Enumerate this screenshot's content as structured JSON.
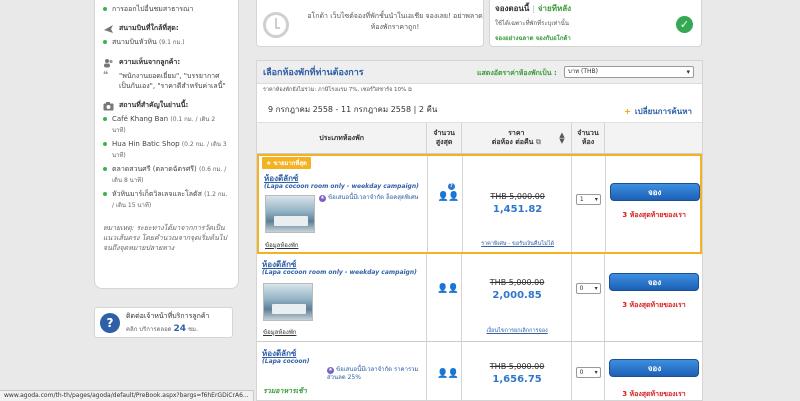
{
  "left": {
    "top_bullet": "การออกไปอื่นชมสาธารณา",
    "airport": {
      "heading": "สนามบินที่ใกล้ที่สุด:",
      "item": "สนามบินหัวหิน",
      "item_dist": "(9.1 กม.)"
    },
    "reviews": {
      "heading": "ความเห็นจากลูกค้า:",
      "quote": "\"พนักงานยอดเยี่ยม\", \"บรรยากาศเป็นกันเอง\", \"ราคาดีสำหรับค่าเลนี้\""
    },
    "landmarks": {
      "heading": "สถานที่สำคัญในย่านนี้:",
      "items": [
        {
          "name": "Café Khang Ban",
          "dist": "(0.1 กม. / เดิน 2 นาที)"
        },
        {
          "name": "Hua Hin Batic Shop",
          "dist": "(0.2 กม. / เดิน 3 นาที)"
        },
        {
          "name": "ตลาดสวนศรี (ตลาดฉัตรศรี)",
          "dist": "(0.6 กม. / เดิน 8 นาที)"
        },
        {
          "name": "หัวหินมาร์เก็ตวิลเลจและโลตัส",
          "dist": "(1.2 กม. / เดิน 15 นาที)"
        }
      ]
    },
    "note": "หมายเหตุ: ระยะทางได้มาจากการวัดเป็นแนวเส้นตรง โดยคำนวณจากจุดเริ่มต้นไปจนถึงจุดหมายปลายทาง",
    "help": {
      "title": "ติดต่อเจ้าหน้าที่บริการลูกค้า",
      "click": "คลิก",
      "service": "บริการตลอด",
      "hours": "24",
      "unit": "ชม."
    }
  },
  "banner1": {
    "text": "อโกด้า เว็บไซต์จองที่พักชั้นนำในเอเชีย จองเลย! อย่าพลาดห้องพักราคาถูก!"
  },
  "banner2": {
    "title_a": "จองตอนนี้",
    "title_b": "จ่ายทีหลัง",
    "line1": "ใช้ได้เฉพาะที่พักที่ระบุเท่านั้น",
    "line2": "จองอย่างฉลาด จองกับอโกด้า"
  },
  "room": {
    "heading": "เลือกห้องพักที่ท่านต้องการ",
    "currency_label": "แสดงอัตราค่าห้องพักเป็น :",
    "currency_value": "บาท (THB)",
    "tax_note": "ราคาห้องพักยังไม่รวม: ภาษีโรงแรม 7%, เซอร์วิสชาร์จ 10%",
    "dates": "9 กรกฎาคม 2558 - 11 กรกฎาคม 2558 | 2 คืน",
    "change_search": "เปลี่ยนการค้นหา",
    "columns": {
      "type": "ประเภทห้องพัก",
      "max_a": "จำนวน",
      "max_b": "สูงสุด",
      "price_a": "ราคา",
      "price_b": "ต่อห้อง ต่อคืน",
      "rooms_a": "จำนวน",
      "rooms_b": "ห้อง"
    },
    "rows": [
      {
        "badge": "ขายมากที่สุด",
        "name": "ห้องดีลักซ์",
        "sub": "(Lapa cocoon room only - weekday campaign)",
        "promo": "ข้อเสนอนี้มีเวลาจำกัด ล็อคสุดพิเศษ",
        "info": "ข้อมูลห้องพัก",
        "old_price": "THB 5,000.00",
        "new_price": "1,451.82",
        "cancel": "ราคาพิเศษ - ขอรับเงินคืนไม่ได้",
        "qty": "1",
        "book": "จอง",
        "left": "3 ห้องสุดท้ายของเรา"
      },
      {
        "name": "ห้องดีลักซ์",
        "sub": "(Lapa cocoon room only - weekday campaign)",
        "info": "ข้อมูลห้องพัก",
        "old_price": "THB 5,000.00",
        "new_price": "2,000.85",
        "cancel": "เงื่อนไขการยกเลิกการจอง",
        "qty": "0",
        "book": "จอง",
        "left": "3 ห้องสุดท้ายของเรา"
      },
      {
        "name": "ห้องดีลักซ์",
        "sub": "(Lapa cocoon)",
        "promo": "ข้อเสนอนี้มีเวลาจำกัด ราคารวมส่วนลด 25%",
        "meal": "รวมอาหารเช้า",
        "old_price": "THB 5,000.00",
        "new_price": "1,656.75",
        "qty": "0",
        "book": "จอง",
        "left": "3 ห้องสุดท้ายของเรา"
      }
    ]
  },
  "statusbar": "www.agoda.com/th-th/pages/agoda/default/PreBook.aspx?bargs=f6hErGDiCrA6..."
}
